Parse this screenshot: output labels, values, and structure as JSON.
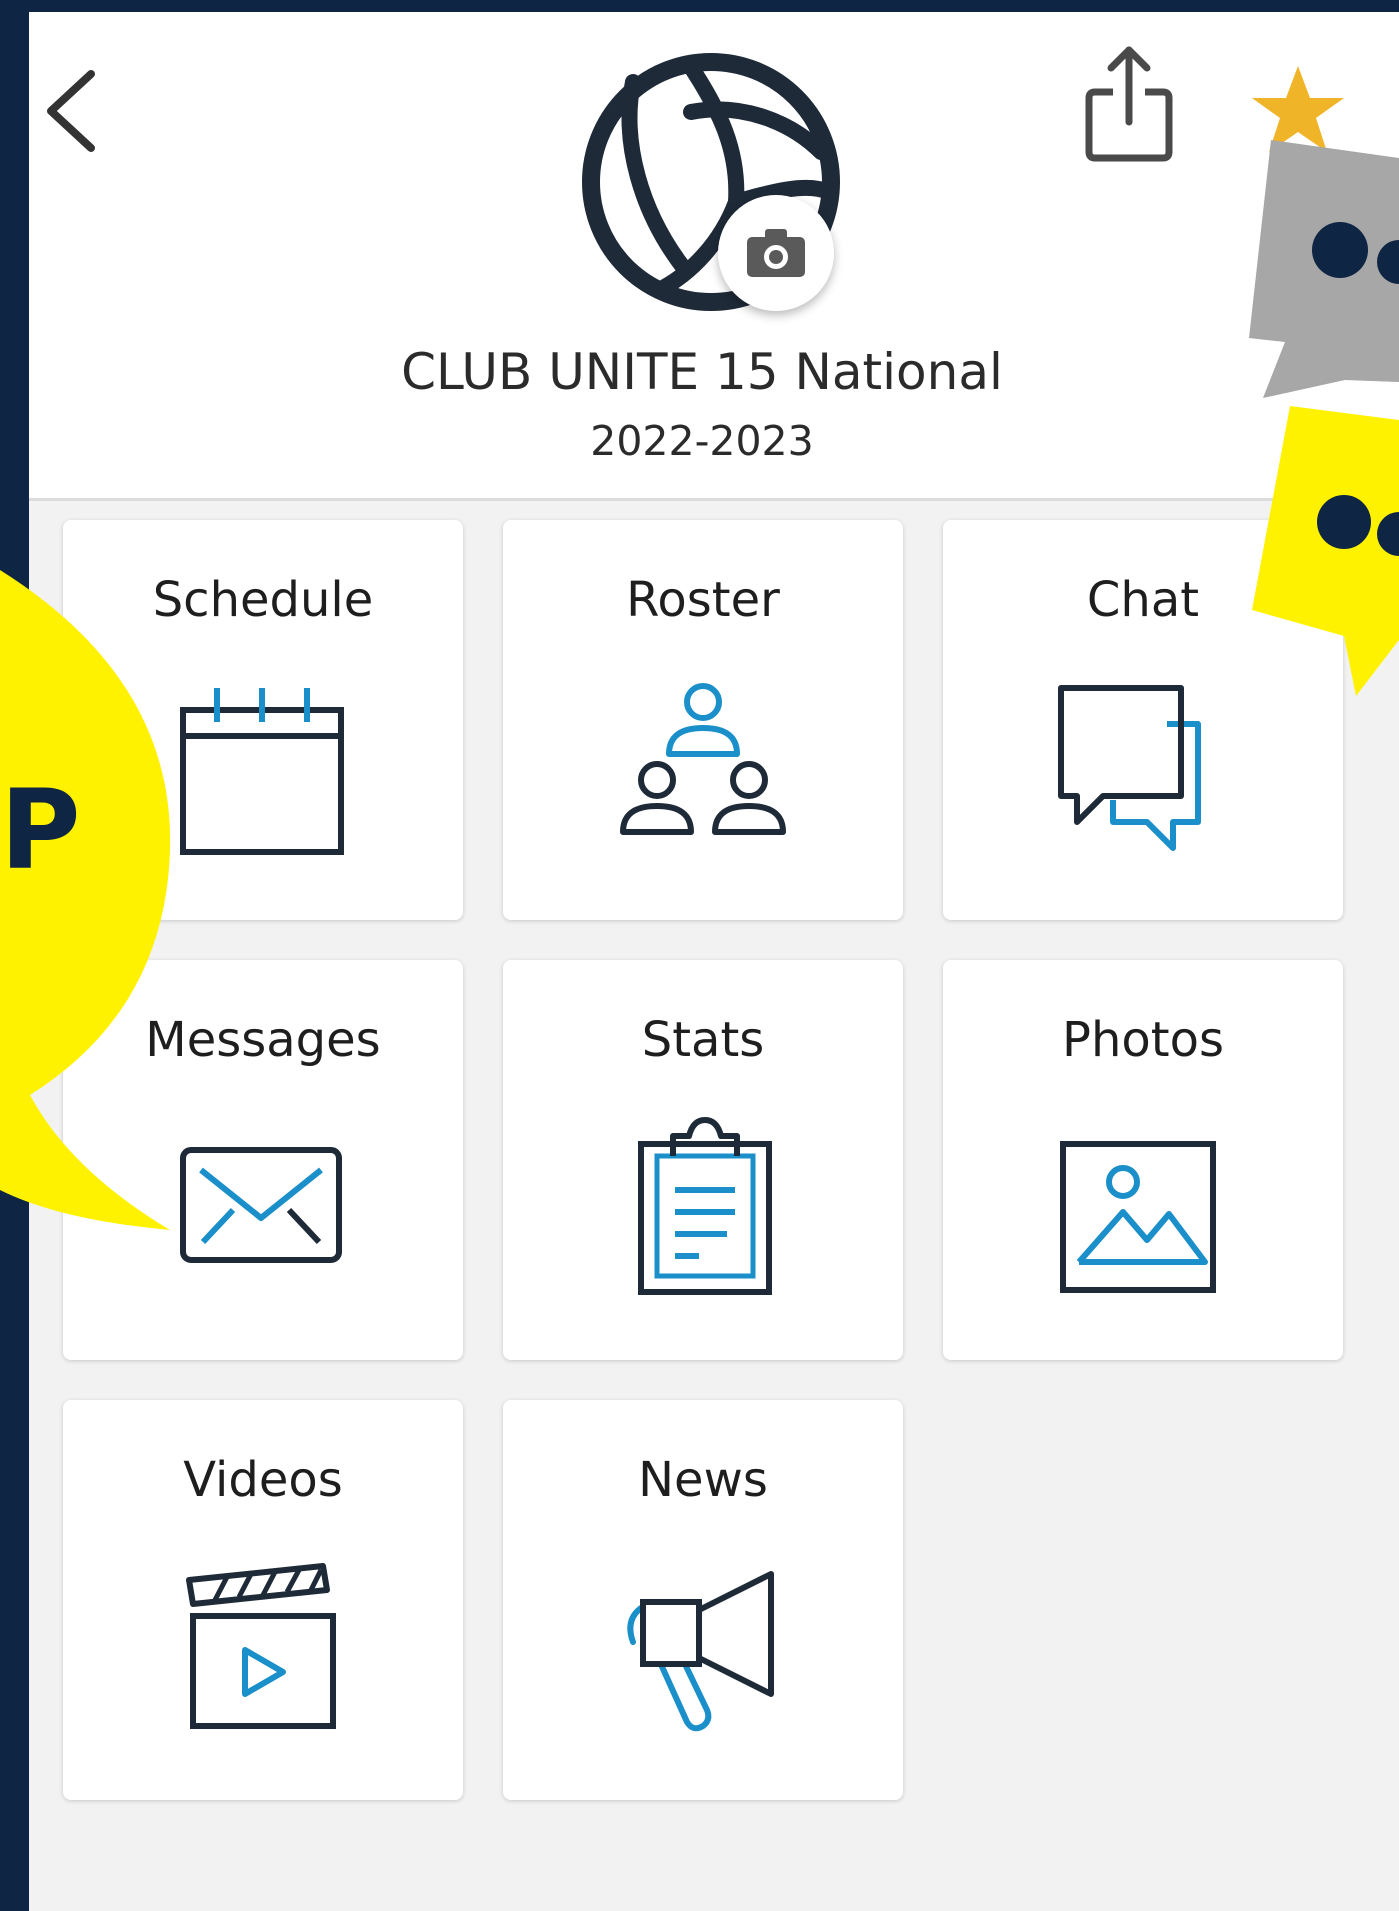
{
  "header": {
    "team_name": "CLUB UNITE 15 National",
    "season": "2022-2023"
  },
  "tiles": [
    {
      "label": "Schedule",
      "icon": "calendar-icon"
    },
    {
      "label": "Roster",
      "icon": "roster-people-icon"
    },
    {
      "label": "Chat",
      "icon": "chat-bubbles-icon"
    },
    {
      "label": "Messages",
      "icon": "envelope-icon"
    },
    {
      "label": "Stats",
      "icon": "clipboard-icon"
    },
    {
      "label": "Photos",
      "icon": "image-icon"
    },
    {
      "label": "Videos",
      "icon": "clapperboard-icon"
    },
    {
      "label": "News",
      "icon": "megaphone-icon"
    }
  ],
  "overlay": {
    "left_bubble_text": "P"
  },
  "colors": {
    "background": "#0f2544",
    "accent_blue": "#1a8fc9",
    "dark": "#1e2a38",
    "star": "#f0b429",
    "highlight_yellow": "#fff200",
    "bubble_gray": "#a7a7a7"
  }
}
